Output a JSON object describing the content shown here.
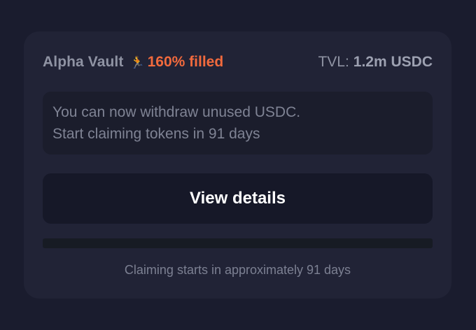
{
  "card": {
    "vault_name": "Alpha Vault",
    "status_icon": "running-person-icon",
    "status_emoji": "🏃",
    "filled_text": "160% filled",
    "tvl_label": "TVL:",
    "tvl_value": "1.2m USDC",
    "notice": {
      "line1": "You can now withdraw unused USDC.",
      "line2": "Start claiming tokens in 91 days"
    },
    "view_details_label": "View details",
    "claim_progress": 0,
    "footer": "Claiming starts in approximately 91 days"
  },
  "colors": {
    "background": "#1a1c2e",
    "card": "#212336",
    "accent_filled": "#f26a3d",
    "button": "#161828",
    "button_text": "#ffffff"
  }
}
